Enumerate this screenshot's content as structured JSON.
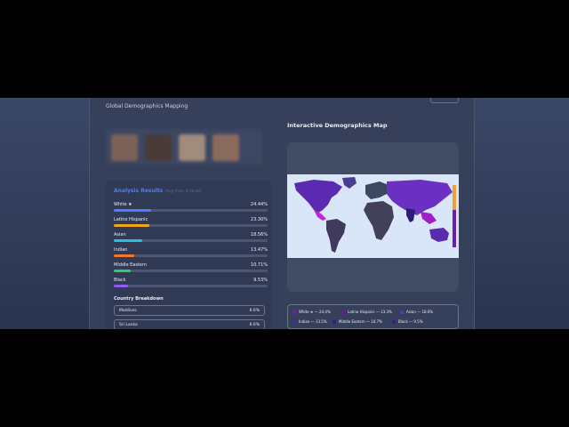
{
  "header": {
    "subtitle": "Global Demographics Mapping"
  },
  "results": {
    "title": "Analysis Results",
    "subtitle": "(Avg from 4 faces)",
    "items": [
      {
        "label": "White ★",
        "value": "24.44%",
        "percent": 24.44,
        "color": "#4a7dff"
      },
      {
        "label": "Latino Hispanic",
        "value": "23.30%",
        "percent": 23.3,
        "color": "#f2a51a"
      },
      {
        "label": "Asian",
        "value": "18.56%",
        "percent": 18.56,
        "color": "#27c2d9"
      },
      {
        "label": "Indian",
        "value": "13.47%",
        "percent": 13.47,
        "color": "#f07a2a"
      },
      {
        "label": "Middle Eastern",
        "value": "10.71%",
        "percent": 10.71,
        "color": "#2ecc71"
      },
      {
        "label": "Black",
        "value": "9.53%",
        "percent": 9.53,
        "color": "#8e5cf5"
      }
    ]
  },
  "country_breakdown": {
    "title": "Country Breakdown",
    "items": [
      {
        "name": "Maldives",
        "value": "6.6%"
      },
      {
        "name": "Sri Lanka",
        "value": "6.6%"
      }
    ]
  },
  "map": {
    "title": "Interactive Demographics Map"
  },
  "legend": {
    "items": [
      {
        "label": "White ★ — 24.4%",
        "color": "#7b1fa2"
      },
      {
        "label": "Latino Hispanic — 23.3%",
        "color": "#6a1b9a"
      },
      {
        "label": "Asian — 18.6%",
        "color": "#5e35b1"
      },
      {
        "label": "Indian — 13.5%",
        "color": "#4527a0"
      },
      {
        "label": "Middle Eastern — 10.7%",
        "color": "#311b92"
      },
      {
        "label": "Black — 9.5%",
        "color": "#4a148c"
      }
    ]
  }
}
